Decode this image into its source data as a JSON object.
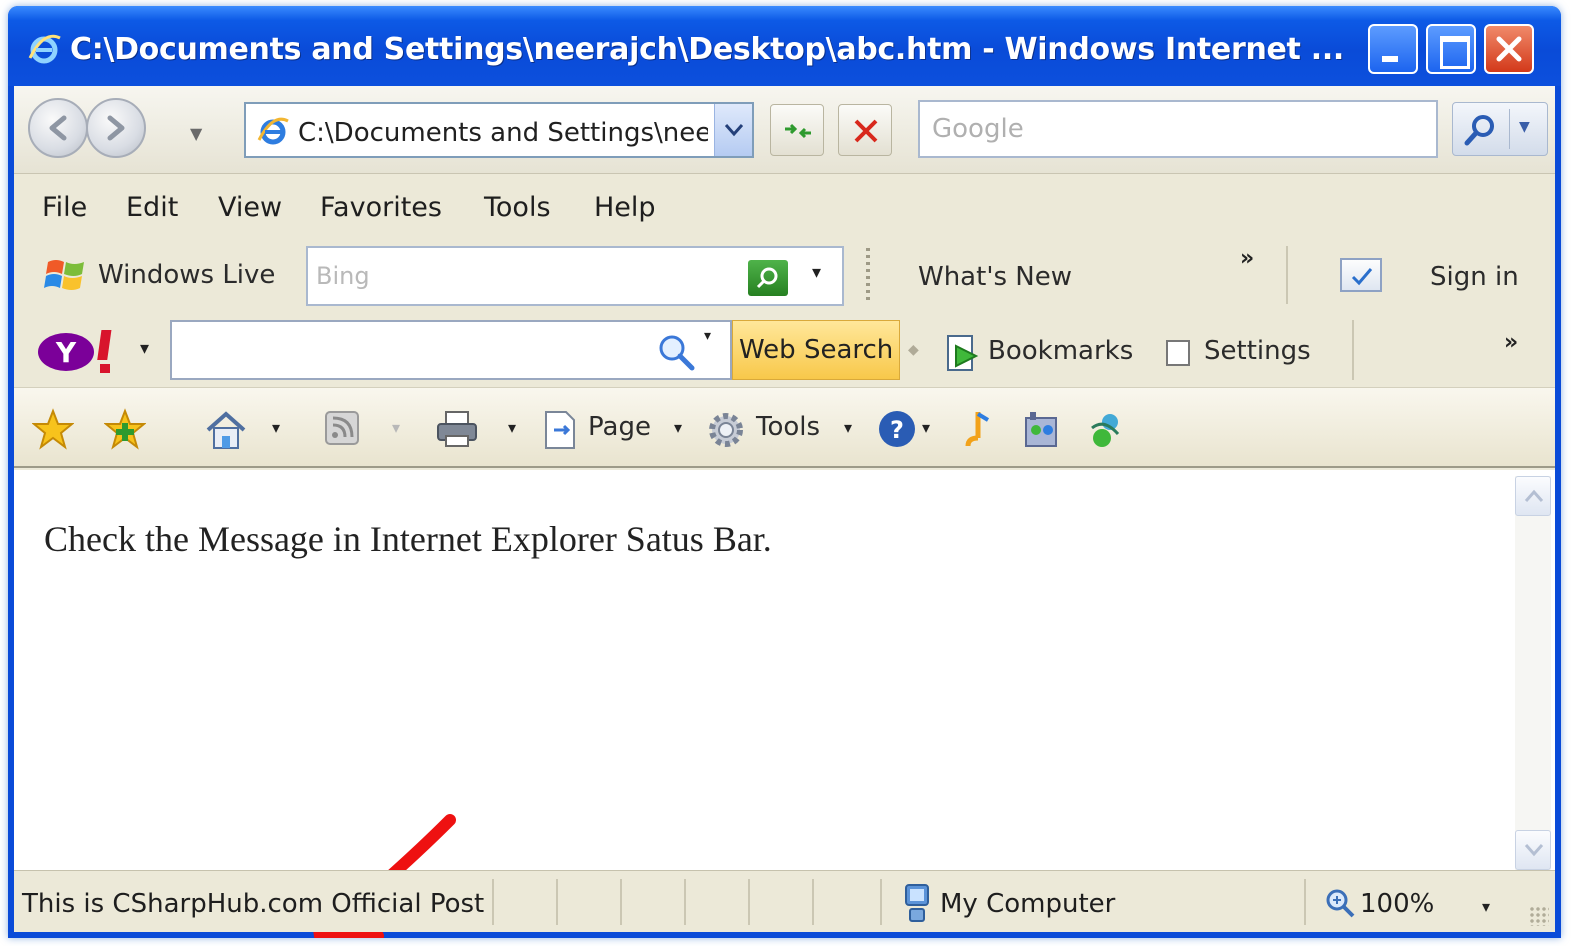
{
  "window": {
    "title": "C:\\Documents and Settings\\neerajch\\Desktop\\abc.htm - Windows Internet ...",
    "colors": {
      "titlebar": "#0a4bd8",
      "close": "#d3391a",
      "frame": "#ece9d8"
    }
  },
  "address_bar": {
    "url": "C:\\Documents and Settings\\neer"
  },
  "search": {
    "placeholder": "Google"
  },
  "menu": {
    "items": [
      "File",
      "Edit",
      "View",
      "Favorites",
      "Tools",
      "Help"
    ]
  },
  "live_toolbar": {
    "logo_label": "Windows Live",
    "search_placeholder": "Bing",
    "whats_new": "What's New",
    "overflow": "»",
    "sign_in": "Sign in"
  },
  "yahoo_toolbar": {
    "logo": "Y!",
    "web_search": "Web Search",
    "bookmarks": "Bookmarks",
    "settings": "Settings",
    "overflow": "»",
    "accent": "#7b0099",
    "button_color": "#f8c84a"
  },
  "command_bar": {
    "page_label": "Page",
    "tools_label": "Tools",
    "icons": [
      "favorites-star-icon",
      "add-favorites-icon",
      "home-icon",
      "feeds-icon",
      "print-icon",
      "page-icon",
      "tools-gear-icon",
      "help-icon",
      "research-icon",
      "messenger-icon",
      "extras-icon"
    ]
  },
  "content": {
    "message": "Check the Message in Internet Explorer Satus Bar."
  },
  "status_bar": {
    "text": "This is CSharpHub.com Official Post",
    "zone": "My Computer",
    "zoom": "100%"
  }
}
